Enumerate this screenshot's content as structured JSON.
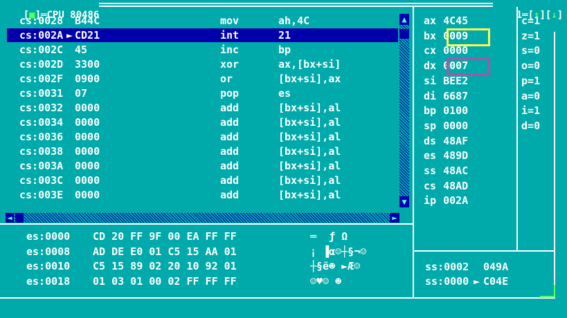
{
  "window": {
    "title": "CPU 80486",
    "left_marker": "[",
    "close_glyph": "■",
    "right_marker": "]",
    "number": "1",
    "zoom_up": "↑",
    "zoom_down": "↓"
  },
  "disasm": [
    {
      "addr": "cs:0028",
      "bytes": "B44C",
      "mnem": "mov",
      "ops": "ah,4C",
      "selected": false
    },
    {
      "addr": "cs:002A",
      "bytes": "CD21",
      "mnem": "int",
      "ops": "21",
      "selected": true,
      "marker": "►"
    },
    {
      "addr": "cs:002C",
      "bytes": "45",
      "mnem": "inc",
      "ops": "bp",
      "selected": false
    },
    {
      "addr": "cs:002D",
      "bytes": "3300",
      "mnem": "xor",
      "ops": "ax,[bx+si]",
      "selected": false
    },
    {
      "addr": "cs:002F",
      "bytes": "0900",
      "mnem": "or",
      "ops": "[bx+si],ax",
      "selected": false
    },
    {
      "addr": "cs:0031",
      "bytes": "07",
      "mnem": "pop",
      "ops": "es",
      "selected": false
    },
    {
      "addr": "cs:0032",
      "bytes": "0000",
      "mnem": "add",
      "ops": "[bx+si],al",
      "selected": false
    },
    {
      "addr": "cs:0034",
      "bytes": "0000",
      "mnem": "add",
      "ops": "[bx+si],al",
      "selected": false
    },
    {
      "addr": "cs:0036",
      "bytes": "0000",
      "mnem": "add",
      "ops": "[bx+si],al",
      "selected": false
    },
    {
      "addr": "cs:0038",
      "bytes": "0000",
      "mnem": "add",
      "ops": "[bx+si],al",
      "selected": false
    },
    {
      "addr": "cs:003A",
      "bytes": "0000",
      "mnem": "add",
      "ops": "[bx+si],al",
      "selected": false
    },
    {
      "addr": "cs:003C",
      "bytes": "0000",
      "mnem": "add",
      "ops": "[bx+si],al",
      "selected": false
    },
    {
      "addr": "cs:003E",
      "bytes": "0000",
      "mnem": "add",
      "ops": "[bx+si],al",
      "selected": false
    }
  ],
  "registers": [
    {
      "name": "ax",
      "value": "4C45"
    },
    {
      "name": "bx",
      "value": "0009"
    },
    {
      "name": "cx",
      "value": "0000"
    },
    {
      "name": "dx",
      "value": "0007"
    },
    {
      "name": "si",
      "value": "BEE2"
    },
    {
      "name": "di",
      "value": "6687"
    },
    {
      "name": "bp",
      "value": "0100"
    },
    {
      "name": "sp",
      "value": "0000"
    },
    {
      "name": "ds",
      "value": "48AF"
    },
    {
      "name": "es",
      "value": "489D"
    },
    {
      "name": "ss",
      "value": "48AC"
    },
    {
      "name": "cs",
      "value": "48AD"
    },
    {
      "name": "ip",
      "value": "002A"
    }
  ],
  "flags": [
    {
      "name": "c",
      "value": "1"
    },
    {
      "name": "z",
      "value": "1"
    },
    {
      "name": "s",
      "value": "0"
    },
    {
      "name": "o",
      "value": "0"
    },
    {
      "name": "p",
      "value": "1"
    },
    {
      "name": "a",
      "value": "0"
    },
    {
      "name": "i",
      "value": "1"
    },
    {
      "name": "d",
      "value": "0"
    }
  ],
  "dump": [
    {
      "addr": "es:0000",
      "bytes": "CD 20 FF 9F 00 EA FF FF",
      "ascii": "═  ƒ Ω"
    },
    {
      "addr": "es:0008",
      "bytes": "AD DE E0 01 C5 15 AA 01",
      "ascii": "¡ ▐α☺┼§¬☺"
    },
    {
      "addr": "es:0010",
      "bytes": "C5 15 89 02 20 10 92 01",
      "ascii": "┼§ë☻ ►Æ☺"
    },
    {
      "addr": "es:0018",
      "bytes": "01 03 01 00 02 FF FF FF",
      "ascii": "☺♥☺ ☻"
    }
  ],
  "stack": [
    {
      "addr": "ss:0002",
      "value": "049A",
      "marker": " "
    },
    {
      "addr": "ss:0000",
      "value": "C04E",
      "marker": "►"
    }
  ],
  "colors": {
    "background": "#00aaaa",
    "selection": "#0000aa",
    "text": "#ffffff",
    "frame_accent": "#55ff55",
    "highlight_bx": "#ffff55",
    "highlight_dx": "#aa55aa"
  }
}
